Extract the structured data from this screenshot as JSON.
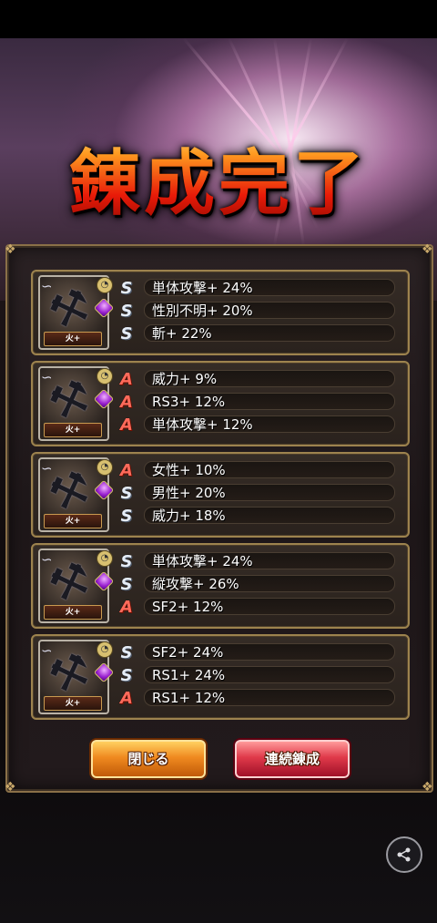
{
  "title": "錬成完了",
  "cards": [
    {
      "element": "火+",
      "stats": [
        {
          "rank": "S",
          "text": "単体攻撃+ 24%"
        },
        {
          "rank": "S",
          "text": "性別不明+ 20%"
        },
        {
          "rank": "S",
          "text": "斬+ 22%"
        }
      ]
    },
    {
      "element": "火+",
      "stats": [
        {
          "rank": "A",
          "text": "威力+ 9%"
        },
        {
          "rank": "A",
          "text": "RS3+ 12%"
        },
        {
          "rank": "A",
          "text": "単体攻撃+ 12%"
        }
      ]
    },
    {
      "element": "火+",
      "stats": [
        {
          "rank": "A",
          "text": "女性+ 10%"
        },
        {
          "rank": "S",
          "text": "男性+ 20%"
        },
        {
          "rank": "S",
          "text": "威力+ 18%"
        }
      ]
    },
    {
      "element": "火+",
      "stats": [
        {
          "rank": "S",
          "text": "単体攻撃+ 24%"
        },
        {
          "rank": "S",
          "text": "縦攻撃+ 26%"
        },
        {
          "rank": "A",
          "text": "SF2+ 12%"
        }
      ]
    },
    {
      "element": "火+",
      "stats": [
        {
          "rank": "S",
          "text": "SF2+ 24%"
        },
        {
          "rank": "S",
          "text": "RS1+ 24%"
        },
        {
          "rank": "A",
          "text": "RS1+ 12%"
        }
      ]
    }
  ],
  "buttons": {
    "close": "閉じる",
    "again": "連続錬成"
  },
  "icons": {
    "share": "share-icon",
    "weapon": "axe-icon",
    "gem": "gem-icon"
  },
  "colors": {
    "rank_s": "#e6edf7",
    "rank_a": "#ff6a5a",
    "close_button": "#f08a20",
    "again_button": "#e03a4a"
  }
}
